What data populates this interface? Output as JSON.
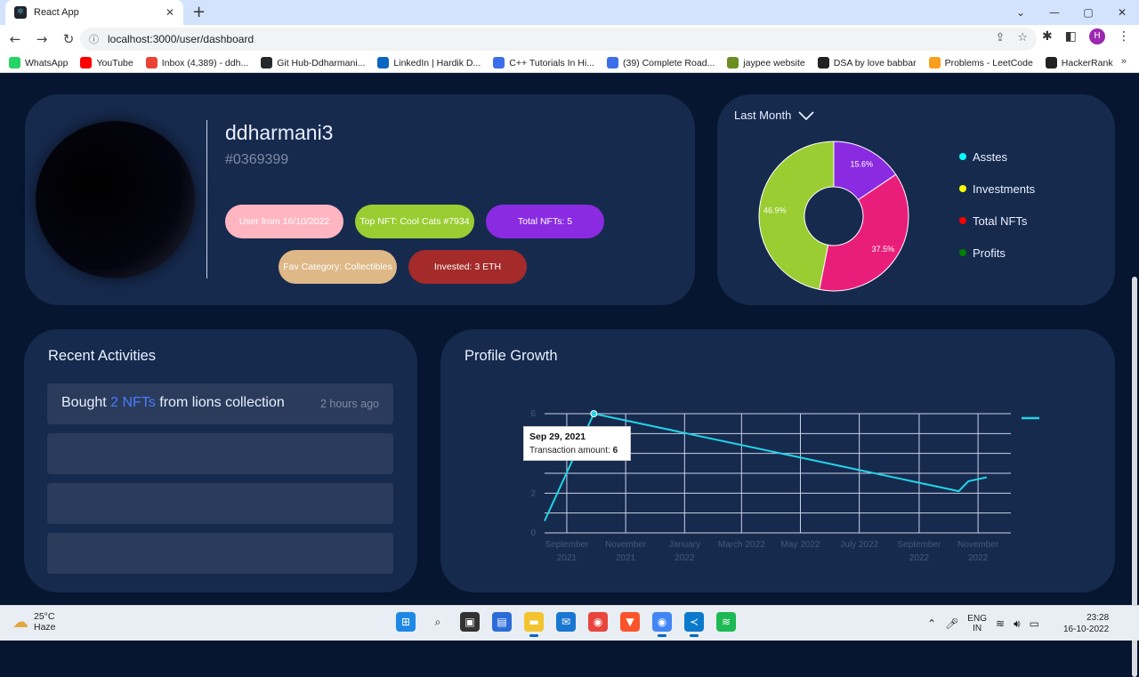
{
  "browser": {
    "tab_title": "React App",
    "tab_close": "✕",
    "new_tab": "+",
    "url": "localhost:3000/user/dashboard",
    "bookmarks": [
      {
        "label": "WhatsApp",
        "color": "#25d366"
      },
      {
        "label": "YouTube",
        "color": "#ff0000"
      },
      {
        "label": "Inbox (4,389) - ddh...",
        "color": "#ea4335"
      },
      {
        "label": "Git Hub-Ddharmani...",
        "color": "#24292e"
      },
      {
        "label": "LinkedIn | Hardik D...",
        "color": "#0a66c2"
      },
      {
        "label": "C++ Tutorials In Hi...",
        "color": "#3b6ee8"
      },
      {
        "label": "(39) Complete Road...",
        "color": "#3b6ee8"
      },
      {
        "label": "jaypee website",
        "color": "#6b8e23"
      },
      {
        "label": "DSA by love babbar",
        "color": "#222222"
      },
      {
        "label": "Problems - LeetCode",
        "color": "#f89f1b"
      },
      {
        "label": "HackerRank",
        "color": "#222222"
      }
    ],
    "bookmarks_more": "»"
  },
  "profile": {
    "username": "ddharmani3",
    "user_id": "#0369399",
    "badges": [
      {
        "text": "User from 16/10/2022",
        "bg": "#ffb6c1",
        "fg": "#ffffff"
      },
      {
        "text": "Top NFT: Cool Cats #7934",
        "bg": "#9acd32",
        "fg": "#ffffff"
      },
      {
        "text": "Total NFTs: 5",
        "bg": "#8a2be2",
        "fg": "#ffffff"
      },
      {
        "text": "Fav Category: Collectibles",
        "bg": "#deb887",
        "fg": "#ffffff"
      },
      {
        "text": "Invested: 3 ETH",
        "bg": "#a52a2a",
        "fg": "#ffffff"
      }
    ]
  },
  "pie": {
    "period": "Last Month",
    "slice_labels": [
      "15.6%",
      "37.5%",
      "46.9%"
    ],
    "legend": [
      {
        "label": "Asstes",
        "color": "#00ffff"
      },
      {
        "label": "Investments",
        "color": "#ffff00"
      },
      {
        "label": "Total NFTs",
        "color": "#ff0000"
      },
      {
        "label": "Profits",
        "color": "#008000"
      }
    ]
  },
  "activities": {
    "title": "Recent Activities",
    "items": [
      {
        "prefix": "Bought ",
        "highlight": "2 NFTs",
        "suffix": " from lions collection",
        "time": "2 hours ago"
      },
      {
        "prefix": "",
        "highlight": "",
        "suffix": "",
        "time": ""
      },
      {
        "prefix": "",
        "highlight": "",
        "suffix": "",
        "time": ""
      },
      {
        "prefix": "",
        "highlight": "",
        "suffix": "",
        "time": ""
      }
    ]
  },
  "growth": {
    "title": "Profile Growth",
    "tooltip_date": "Sep 29, 2021",
    "tooltip_label": "Transaction amount",
    "tooltip_value": "6"
  },
  "chart_data": [
    {
      "type": "pie",
      "title": "",
      "values": [
        15.6,
        37.5,
        46.9
      ],
      "labels": [
        "15.6%",
        "37.5%",
        "46.9%"
      ],
      "colors": [
        "#8a2be2",
        "#e91e7b",
        "#9acd32"
      ]
    },
    {
      "type": "line",
      "title": "",
      "xlabel": "",
      "ylabel": "",
      "x": [
        "2021-08-20",
        "2021-09-29",
        "2022-10-12",
        "2022-10-22",
        "2022-11-10"
      ],
      "series": [
        {
          "values": [
            0.6,
            6,
            2.1,
            2.6,
            2.8
          ],
          "color": "#22d3e6"
        }
      ],
      "x_ticks": [
        [
          "September",
          "2021"
        ],
        [
          "November",
          "2021"
        ],
        [
          "January",
          "2022"
        ],
        [
          "March 2022"
        ],
        [
          "May 2022"
        ],
        [
          "July 2022"
        ],
        [
          "September",
          "2022"
        ],
        [
          "November",
          "2022"
        ]
      ],
      "y_ticks": [
        "0",
        "2",
        "4",
        "6"
      ],
      "ylim": [
        0,
        6
      ],
      "grid": true
    }
  ],
  "taskbar": {
    "temperature": "25°C",
    "condition": "Haze",
    "lang_1": "ENG",
    "lang_2": "IN",
    "time": "23:28",
    "date": "16-10-2022"
  }
}
